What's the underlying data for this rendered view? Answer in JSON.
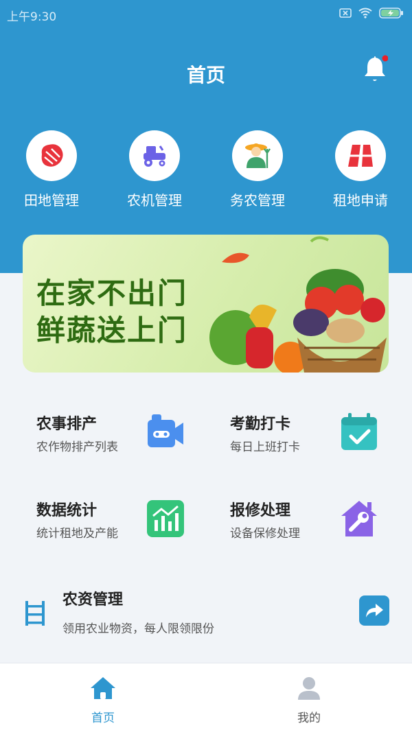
{
  "status": {
    "time": "上午9:30"
  },
  "header": {
    "title": "首页"
  },
  "quick_links": [
    {
      "label": "田地管理",
      "icon": "field-icon"
    },
    {
      "label": "农机管理",
      "icon": "tractor-icon"
    },
    {
      "label": "务农管理",
      "icon": "farmer-icon"
    },
    {
      "label": "租地申请",
      "icon": "lease-icon"
    }
  ],
  "banner": {
    "line1": "在家不出门",
    "line2": "鲜蔬送上门"
  },
  "cards": [
    {
      "title": "农事排产",
      "subtitle": "农作物排产列表",
      "icon": "camera-icon",
      "color": "#4b8fee"
    },
    {
      "title": "考勤打卡",
      "subtitle": "每日上班打卡",
      "icon": "calendar-check-icon",
      "color": "#35c2c1"
    },
    {
      "title": "数据统计",
      "subtitle": "统计租地及产能",
      "icon": "chart-icon",
      "color": "#34c47a"
    },
    {
      "title": "报修处理",
      "subtitle": "设备保修处理",
      "icon": "wrench-house-icon",
      "color": "#8a63e6"
    }
  ],
  "supplies": {
    "title": "农资管理",
    "subtitle": "领用农业物资，每人限领限份"
  },
  "tabs": [
    {
      "label": "首页",
      "active": true
    },
    {
      "label": "我的",
      "active": false
    }
  ],
  "colors": {
    "primary": "#2e96cf",
    "background": "#f1f4f8",
    "badge": "#e8202a"
  }
}
